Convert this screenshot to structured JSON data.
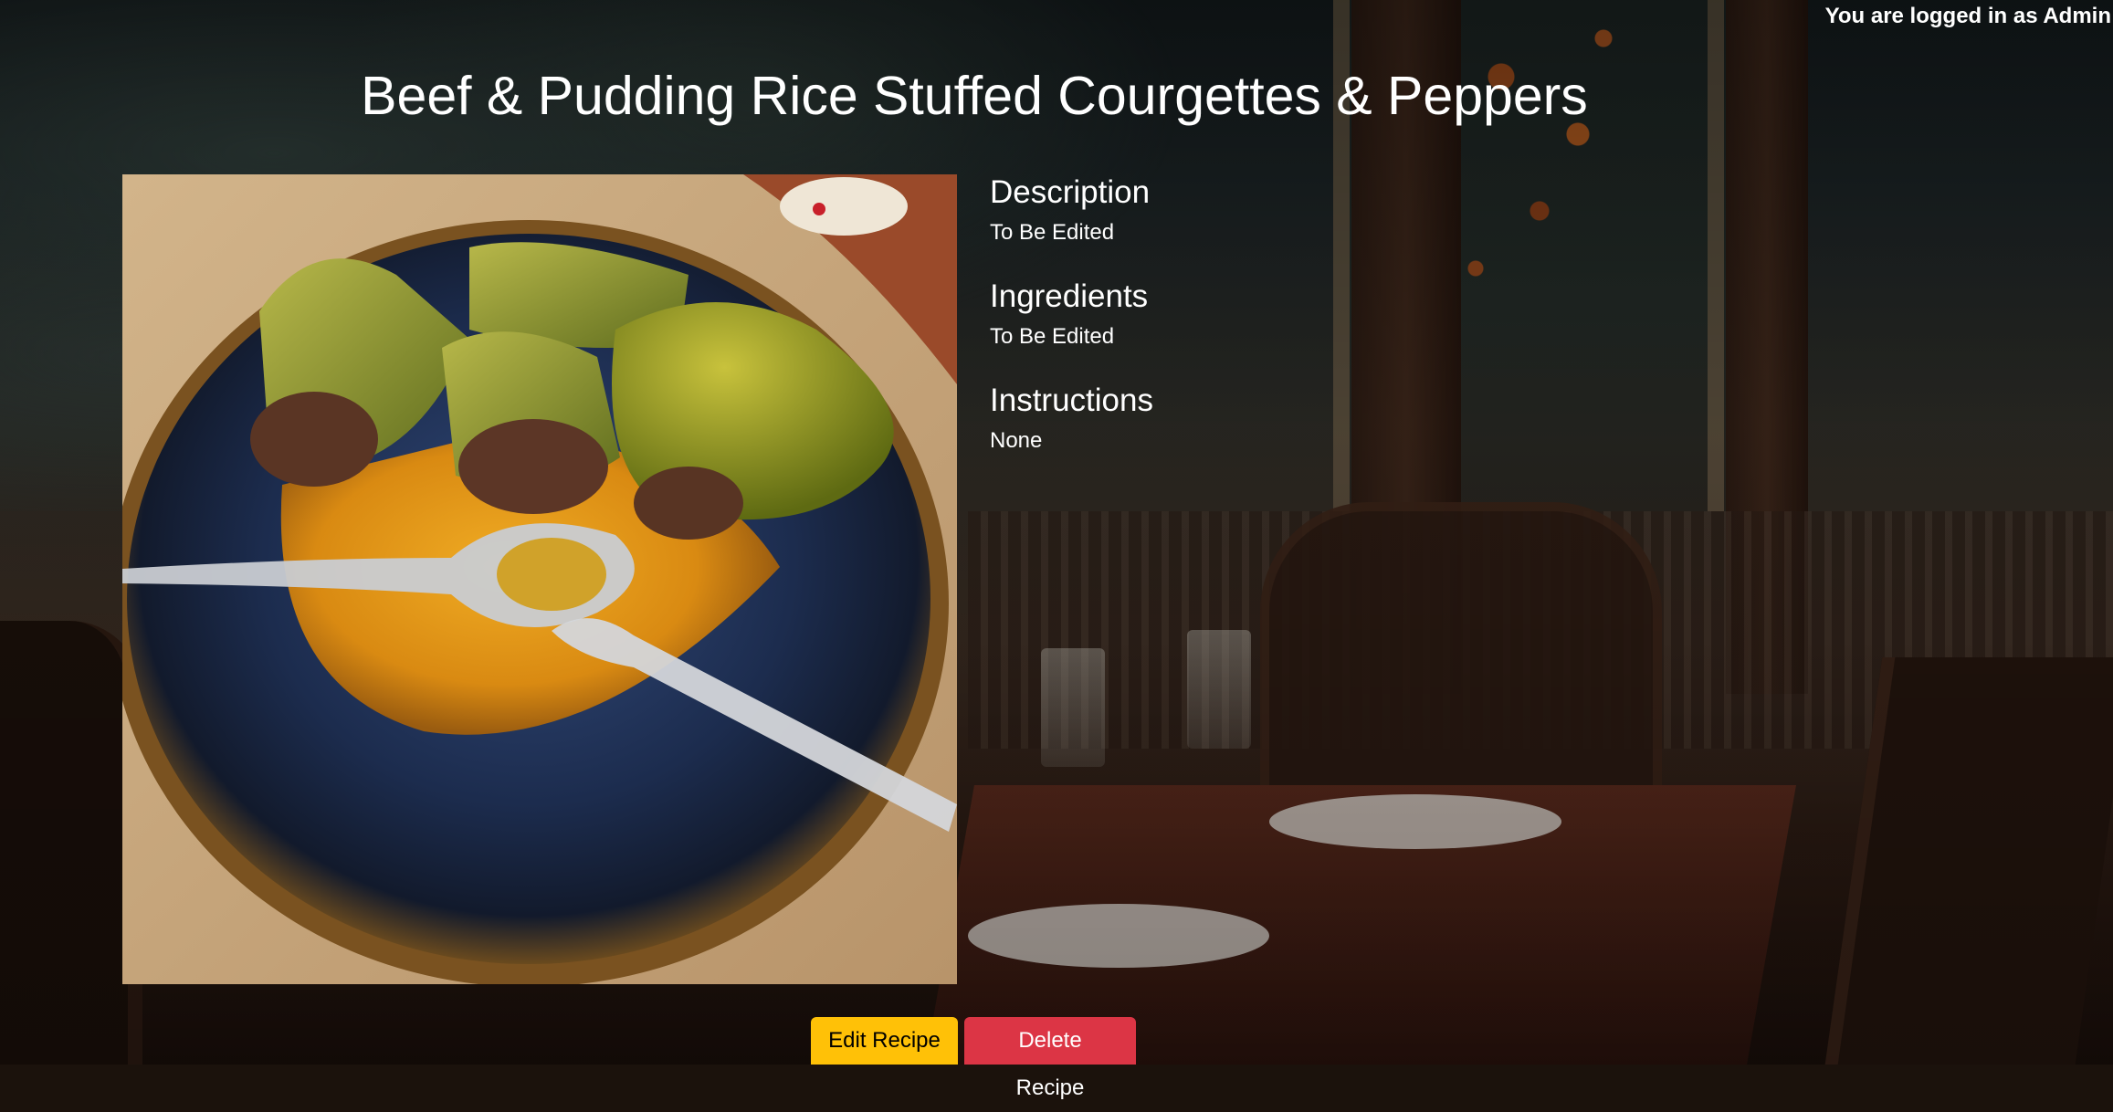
{
  "header": {
    "login_status": "You are logged in as Admin"
  },
  "recipe": {
    "title": "Beef & Pudding Rice Stuffed Courgettes & Peppers",
    "photo_subject": "stuffed courgettes and pepper in a blue bowl with spoons",
    "sections": [
      {
        "heading": "Description",
        "text": "To Be Edited"
      },
      {
        "heading": "Ingredients",
        "text": "To Be Edited"
      },
      {
        "heading": "Instructions",
        "text": "None"
      }
    ]
  },
  "actions": {
    "edit_label": "Edit Recipe",
    "delete_label": "Delete Recipe"
  },
  "colors": {
    "edit_button": "#ffc107",
    "delete_button": "#dc3545",
    "text": "#ffffff"
  }
}
